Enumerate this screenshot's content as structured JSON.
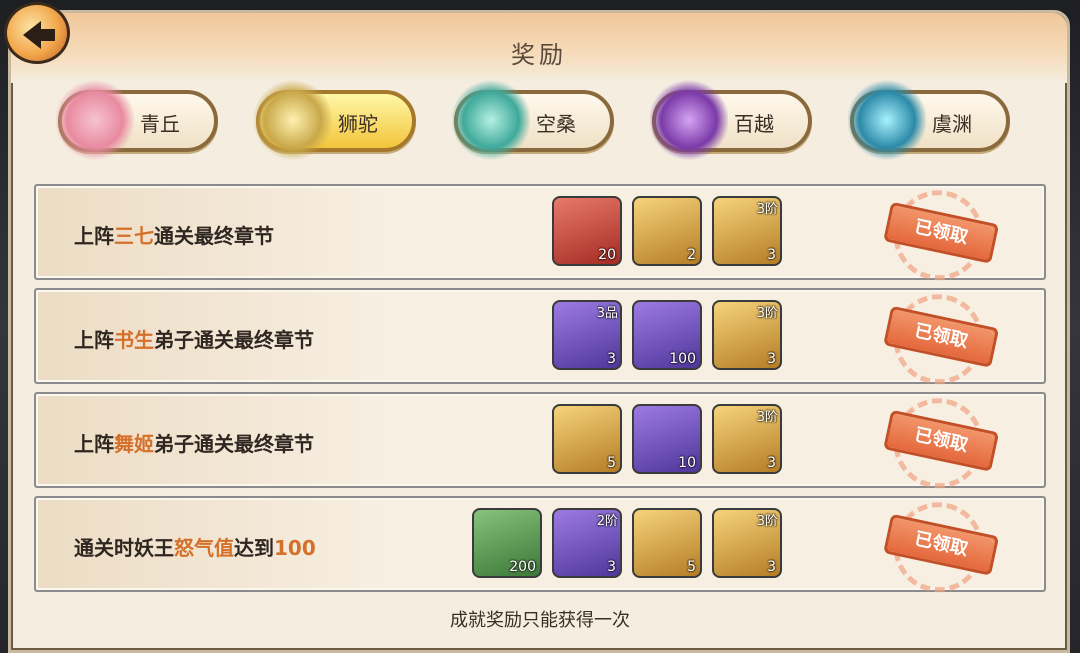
{
  "title": "奖励",
  "tabs": [
    {
      "label": "青丘",
      "active": false,
      "color": "#f1a1b4"
    },
    {
      "label": "狮驼",
      "active": true,
      "color": "#d7c16a"
    },
    {
      "label": "空桑",
      "active": false,
      "color": "#57c7b5"
    },
    {
      "label": "百越",
      "active": false,
      "color": "#8a4bc1"
    },
    {
      "label": "虞渊",
      "active": false,
      "color": "#3fb4c8"
    }
  ],
  "rows": [
    {
      "text_prefix": "上阵",
      "highlight": "三七",
      "text_suffix": "通关最终章节",
      "items": [
        {
          "icon": "crystal-icon",
          "qty": "20",
          "tier": "",
          "style": "red"
        },
        {
          "icon": "orb-icon",
          "qty": "2",
          "tier": "",
          "style": "yellow"
        },
        {
          "icon": "crate-icon",
          "qty": "3",
          "tier": "3阶",
          "style": "yellow"
        }
      ],
      "status": "已领取"
    },
    {
      "text_prefix": "上阵",
      "highlight": "书生",
      "text_suffix": "弟子通关最终章节",
      "items": [
        {
          "icon": "flame-leaf-icon",
          "qty": "3",
          "tier": "3品",
          "style": "purple"
        },
        {
          "icon": "talisman-icon",
          "qty": "100",
          "tier": "",
          "style": "purple"
        },
        {
          "icon": "ingot-chest-icon",
          "qty": "3",
          "tier": "3阶",
          "style": "yellow"
        }
      ],
      "status": "已领取"
    },
    {
      "text_prefix": "上阵",
      "highlight": "舞姬",
      "text_suffix": "弟子通关最终章节",
      "items": [
        {
          "icon": "coin-icon",
          "qty": "5",
          "tier": "",
          "style": "yellow"
        },
        {
          "icon": "gem-shard-icon",
          "qty": "10",
          "tier": "",
          "style": "purple"
        },
        {
          "icon": "logs-icon",
          "qty": "3",
          "tier": "3阶",
          "style": "yellow"
        }
      ],
      "status": "已领取"
    },
    {
      "text_prefix": "通关时妖王",
      "highlight": "怒气值",
      "text_suffix": "达到",
      "highlight2": "100",
      "items": [
        {
          "icon": "jade-hook-icon",
          "qty": "200",
          "tier": "",
          "style": "green"
        },
        {
          "icon": "scroll-bundle-icon",
          "qty": "3",
          "tier": "2阶",
          "style": "purple"
        },
        {
          "icon": "essence-drop-icon",
          "qty": "5",
          "tier": "",
          "style": "yellow"
        },
        {
          "icon": "book-stack-icon",
          "qty": "3",
          "tier": "3阶",
          "style": "yellow"
        }
      ],
      "status": "已领取"
    }
  ],
  "footer": "成就奖励只能获得一次"
}
